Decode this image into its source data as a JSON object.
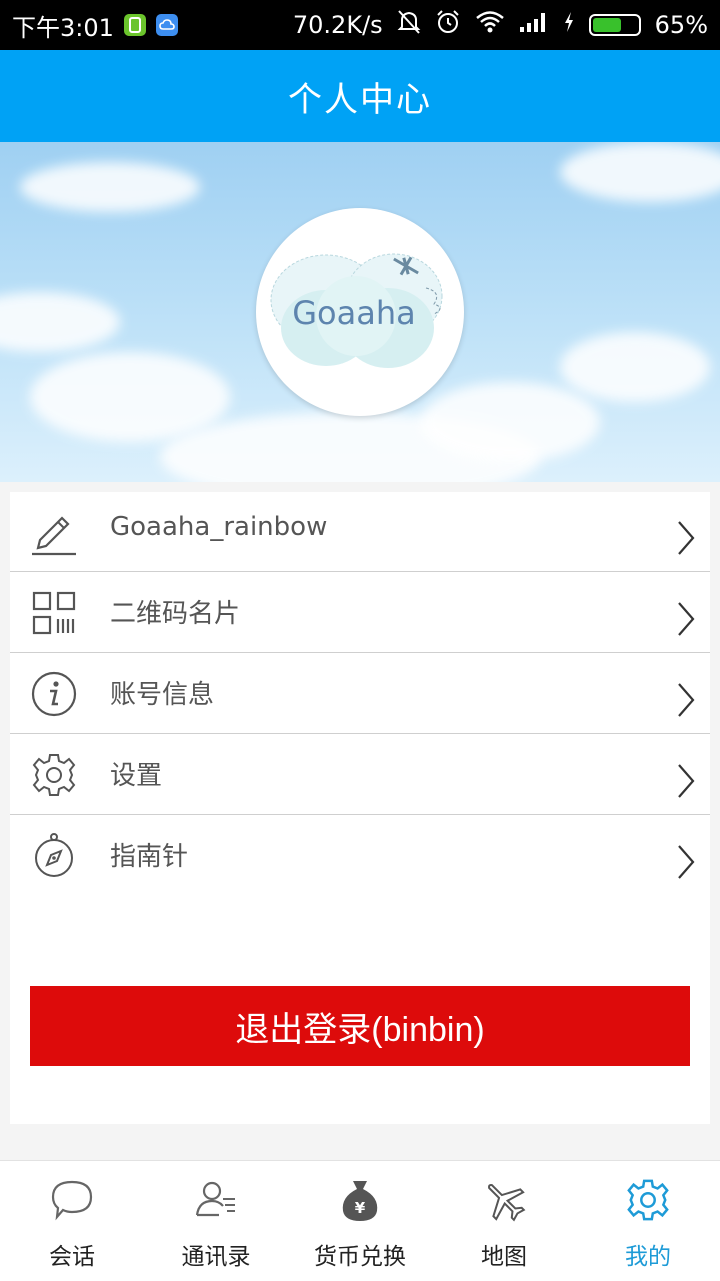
{
  "status_bar": {
    "time": "下午3:01",
    "speed": "70.2K/s",
    "battery_percent": "65%",
    "battery_level": 0.65
  },
  "header": {
    "title": "个人中心"
  },
  "profile": {
    "avatar_text": "Goaaha"
  },
  "menu": [
    {
      "label": "Goaaha_rainbow",
      "icon": "edit-pencil-icon"
    },
    {
      "label": "二维码名片",
      "icon": "qr-code-icon"
    },
    {
      "label": "账号信息",
      "icon": "info-icon"
    },
    {
      "label": "设置",
      "icon": "gear-icon"
    },
    {
      "label": "指南针",
      "icon": "compass-icon"
    }
  ],
  "logout_label": "退出登录(binbin)",
  "tabs": [
    {
      "label": "会话",
      "icon": "chat-bubble-icon",
      "active": false
    },
    {
      "label": "通讯录",
      "icon": "contacts-icon",
      "active": false
    },
    {
      "label": "货币兑换",
      "icon": "money-bag-icon",
      "active": false
    },
    {
      "label": "地图",
      "icon": "airplane-icon",
      "active": false
    },
    {
      "label": "我的",
      "icon": "gear-icon",
      "active": true
    }
  ],
  "colors": {
    "header_blue": "#00a2f5",
    "logout_red": "#dd0b0b",
    "active_tab": "#1e9bd7"
  }
}
